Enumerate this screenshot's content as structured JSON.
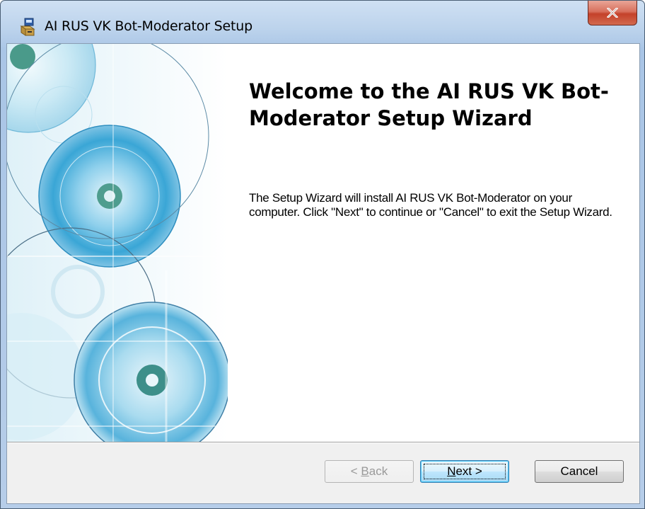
{
  "window": {
    "title": "AI RUS VK Bot-Moderator Setup",
    "icon": "installer-icon",
    "close_icon": "close-icon"
  },
  "wizard": {
    "heading": "Welcome to the AI RUS VK Bot-Moderator Setup Wizard",
    "description": "The Setup Wizard will install AI RUS VK Bot-Moderator on your computer.  Click \"Next\" to continue or \"Cancel\" to exit the Setup Wizard."
  },
  "buttons": {
    "back": {
      "prefix": "< ",
      "accel": "B",
      "rest": "ack",
      "enabled": false
    },
    "next": {
      "accel": "N",
      "rest": "ext >",
      "enabled": true
    },
    "cancel": {
      "label": "Cancel",
      "enabled": true
    }
  },
  "colors": {
    "accent_blue": "#3aa6d6",
    "teal": "#4a9a8a",
    "close_red": "#c4412a"
  }
}
